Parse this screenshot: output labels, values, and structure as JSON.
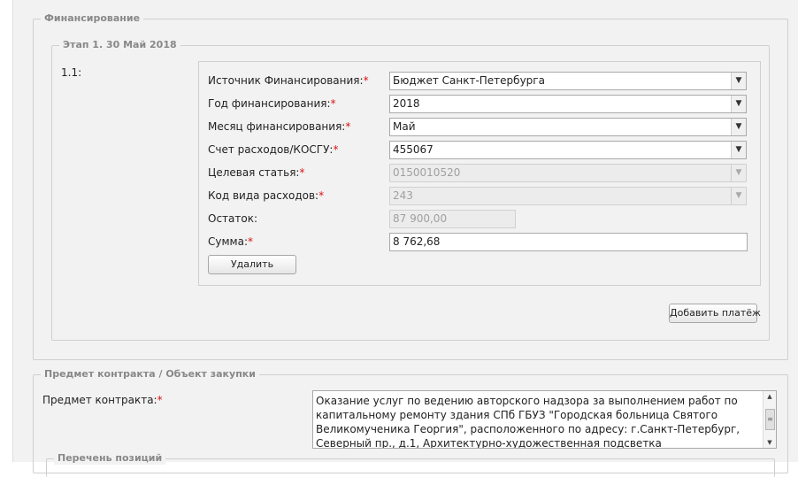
{
  "financing": {
    "legend": "Финансирование",
    "stage": {
      "legend": "Этап 1. 30 Май 2018",
      "row_number": "1.1:",
      "required_mark": "*",
      "fields": {
        "source": {
          "label": "Источник Финансирования:",
          "value": "Бюджет Санкт-Петербурга"
        },
        "year": {
          "label": "Год финансирования:",
          "value": "2018"
        },
        "month": {
          "label": "Месяц финансирования:",
          "value": "Май"
        },
        "account": {
          "label": "Счет расходов/КОСГУ:",
          "value": "455067"
        },
        "target": {
          "label": "Целевая статья:",
          "value": "0150010520"
        },
        "expense_code": {
          "label": "Код вида расходов:",
          "value": "243"
        },
        "balance": {
          "label": "Остаток:",
          "value": "87 900,00"
        },
        "amount": {
          "label": "Сумма:",
          "value": "8 762,68"
        }
      },
      "delete_label": "Удалить"
    },
    "add_payment_label": "Добавить платёж"
  },
  "subject": {
    "legend": "Предмет контракта / Объект закупки",
    "label": "Предмет контракта:",
    "text": "Оказание услуг по ведению авторского надзора за выполнением работ по капитальному ремонту здания СПб ГБУЗ \"Городская больница Святого Великомученика Георгия\", расположенного по адресу: г.Санкт-Петербург, Северный пр., д.1, Архитектурно-художественная подсветка"
  },
  "positions": {
    "legend": "Перечень позиций"
  },
  "icons": {
    "dropdown": "chevron-down-icon",
    "scroll_up": "scroll-up-icon",
    "scroll_down": "scroll-down-icon"
  }
}
